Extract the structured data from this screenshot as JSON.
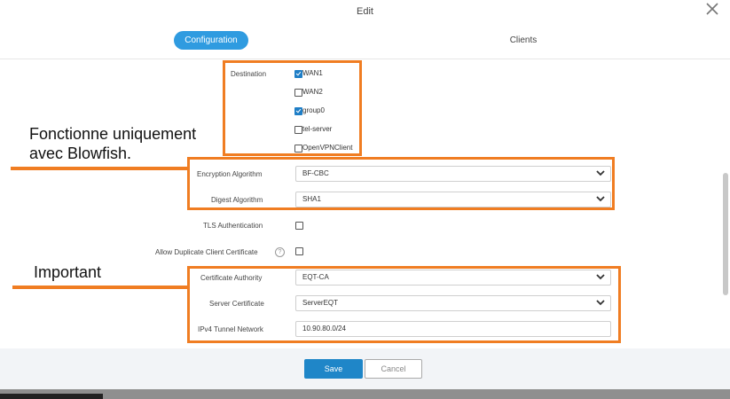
{
  "dialog": {
    "title": "Edit",
    "close_icon": "close-icon"
  },
  "tabs": [
    {
      "label": "Configuration",
      "active": true
    },
    {
      "label": "Clients",
      "active": false
    }
  ],
  "form": {
    "destination": {
      "label": "Destination",
      "options": [
        {
          "label": "WAN1",
          "checked": true
        },
        {
          "label": "WAN2",
          "checked": false
        },
        {
          "label": "group0",
          "checked": true
        },
        {
          "label": "tel-server",
          "checked": false
        },
        {
          "label": "OpenVPNClient",
          "checked": false
        }
      ]
    },
    "encryption_algorithm": {
      "label": "Encryption Algorithm",
      "value": "BF-CBC"
    },
    "digest_algorithm": {
      "label": "Digest Algorithm",
      "value": "SHA1"
    },
    "tls_authentication": {
      "label": "TLS Authentication",
      "checked": false
    },
    "allow_duplicate": {
      "label": "Allow Duplicate Client Certificate",
      "checked": false,
      "help_icon": "help-icon"
    },
    "certificate_authority": {
      "label": "Certificate Authority",
      "value": "EQT-CA"
    },
    "server_certificate": {
      "label": "Server Certificate",
      "value": "ServerEQT"
    },
    "ipv4_tunnel_network": {
      "label": "IPv4 Tunnel Network",
      "value": "10.90.80.0/24"
    }
  },
  "annotations": {
    "blowfish_note": "Fonctionne uniquement avec Blowfish.",
    "important_note": "Important",
    "highlight_color": "#f07d22"
  },
  "footer": {
    "save_label": "Save",
    "cancel_label": "Cancel"
  },
  "colors": {
    "accent": "#2f9be0",
    "save_button": "#1f86c8"
  }
}
